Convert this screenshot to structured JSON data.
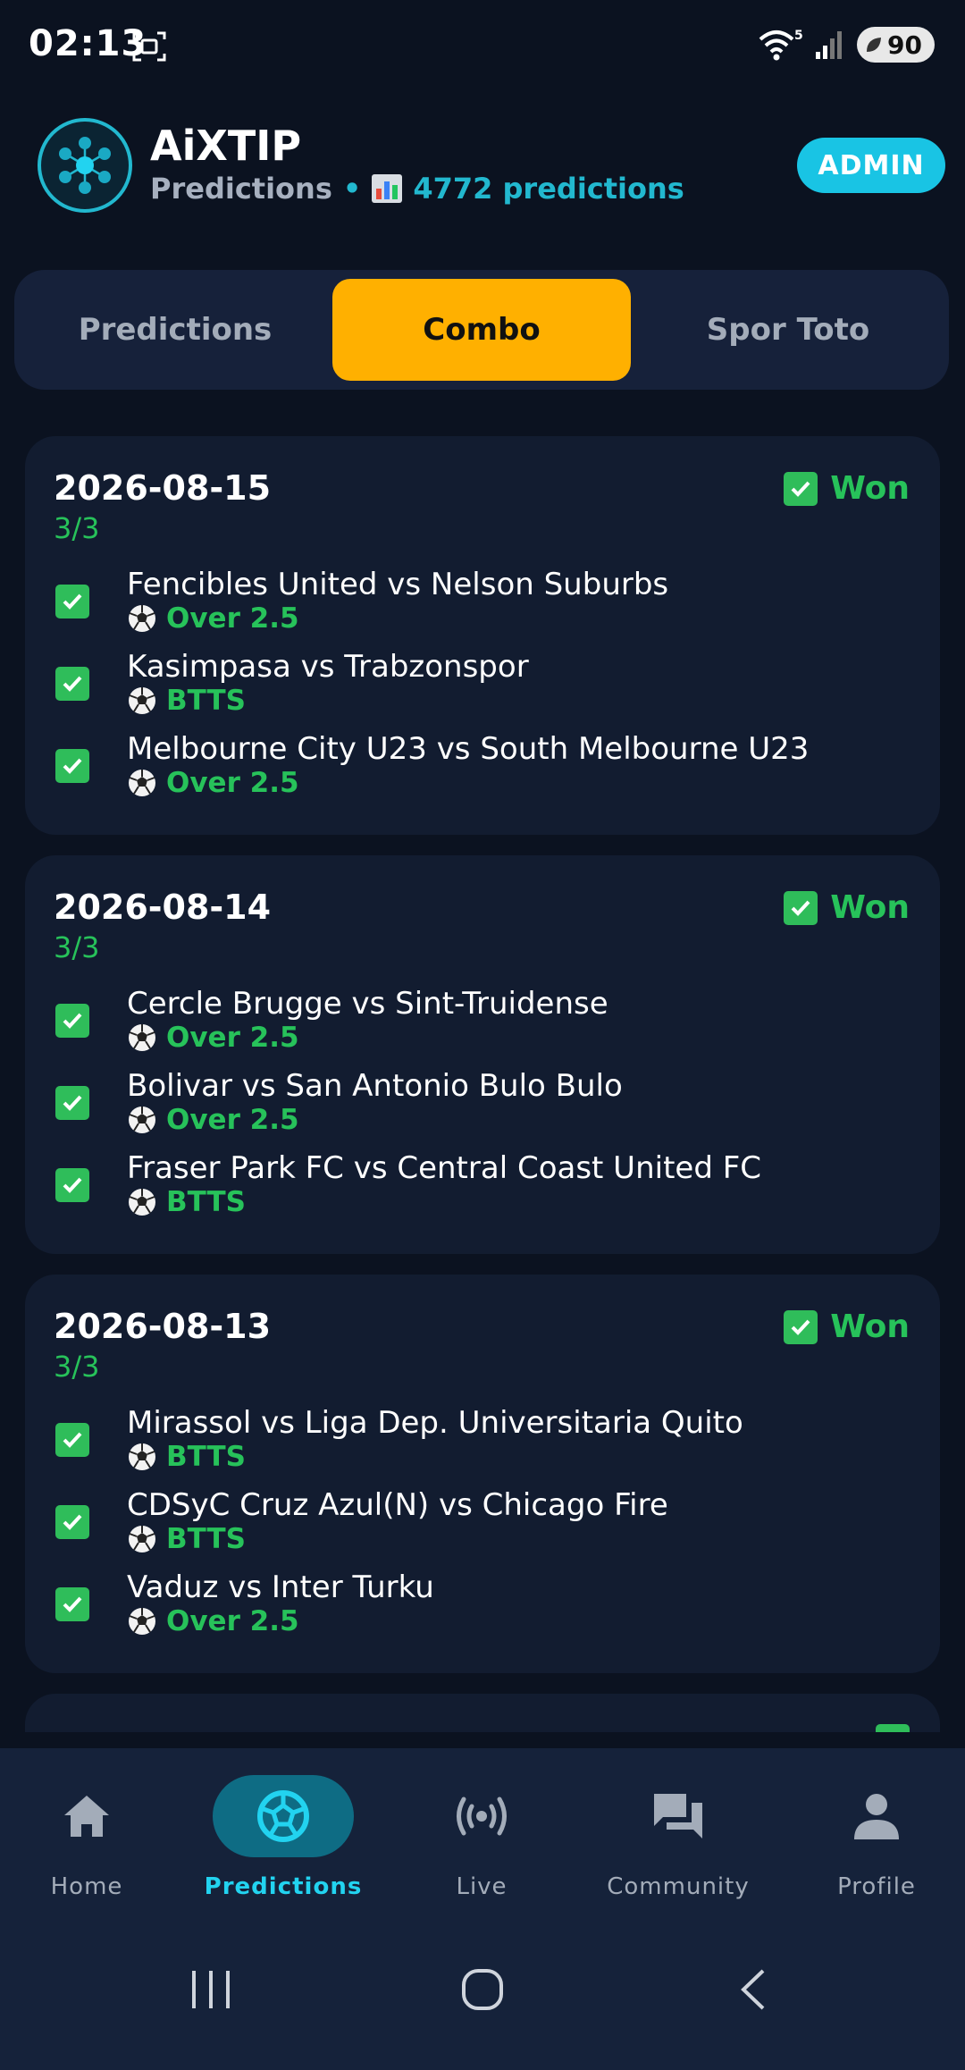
{
  "status_bar": {
    "time": "02:13",
    "battery": "90",
    "network_badge": "5"
  },
  "header": {
    "title": "AiXTIP",
    "subtitle_label": "Predictions",
    "separator": "•",
    "prediction_count": "4772 predictions",
    "admin_label": "ADMIN"
  },
  "tabs": [
    {
      "label": "Predictions",
      "active": false
    },
    {
      "label": "Combo",
      "active": true
    },
    {
      "label": "Spor Toto",
      "active": false
    }
  ],
  "combos": [
    {
      "date": "2026-08-15",
      "score": "3/3",
      "status": "Won",
      "matches": [
        {
          "name": "Fencibles United vs Nelson Suburbs",
          "tip": "Over 2.5"
        },
        {
          "name": "Kasimpasa vs Trabzonspor",
          "tip": "BTTS"
        },
        {
          "name": "Melbourne City U23 vs South Melbourne U23",
          "tip": "Over 2.5"
        }
      ]
    },
    {
      "date": "2026-08-14",
      "score": "3/3",
      "status": "Won",
      "matches": [
        {
          "name": "Cercle Brugge vs Sint-Truidense",
          "tip": "Over 2.5"
        },
        {
          "name": "Bolivar vs San Antonio Bulo Bulo",
          "tip": "Over 2.5"
        },
        {
          "name": "Fraser Park FC vs Central Coast United FC",
          "tip": "BTTS"
        }
      ]
    },
    {
      "date": "2026-08-13",
      "score": "3/3",
      "status": "Won",
      "matches": [
        {
          "name": "Mirassol vs Liga Dep. Universitaria Quito",
          "tip": "BTTS"
        },
        {
          "name": "CDSyC Cruz Azul(N) vs Chicago Fire",
          "tip": "BTTS"
        },
        {
          "name": "Vaduz vs Inter Turku",
          "tip": "Over 2.5"
        }
      ]
    }
  ],
  "bottom_nav": [
    {
      "label": "Home",
      "icon": "home-icon",
      "active": false
    },
    {
      "label": "Predictions",
      "icon": "soccer-ball-icon",
      "active": true
    },
    {
      "label": "Live",
      "icon": "broadcast-icon",
      "active": false
    },
    {
      "label": "Community",
      "icon": "chat-icon",
      "active": false
    },
    {
      "label": "Profile",
      "icon": "person-icon",
      "active": false
    }
  ],
  "colors": {
    "background": "#0b1220",
    "card": "#121c30",
    "accent_cyan": "#19c4e4",
    "accent_yellow": "#ffb000",
    "won_green": "#27c25a"
  }
}
